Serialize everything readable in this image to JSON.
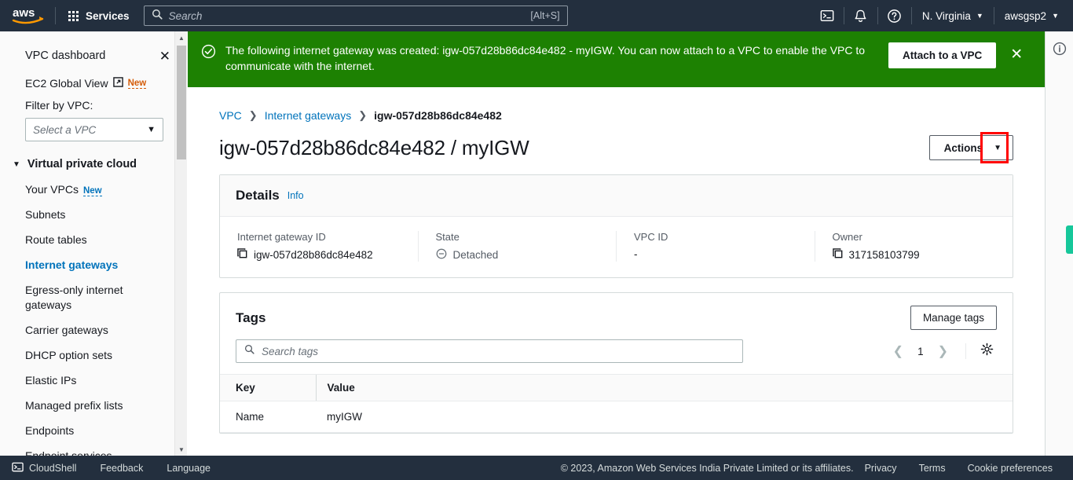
{
  "topnav": {
    "logo_alt": "aws",
    "services_label": "Services",
    "search_placeholder": "Search",
    "search_value": "",
    "search_shortcut": "[Alt+S]",
    "cloudshell_icon": "terminal-icon",
    "notifications_icon": "bell-icon",
    "help_icon": "question-circle-icon",
    "region_label": "N. Virginia",
    "account_label": "awsgsp2"
  },
  "sidebar": {
    "dashboard_label": "VPC dashboard",
    "close_icon": "close-icon",
    "global_view_label": "EC2 Global View",
    "global_view_external_icon": "external-link-icon",
    "global_view_badge": "New",
    "filter_label": "Filter by VPC:",
    "vpc_select_placeholder": "Select a VPC",
    "vpc_select_caret": "chevron-down-icon",
    "section_label": "Virtual private cloud",
    "items": [
      {
        "label": "Your VPCs",
        "badge": "New",
        "active": false
      },
      {
        "label": "Subnets",
        "badge": "",
        "active": false
      },
      {
        "label": "Route tables",
        "badge": "",
        "active": false
      },
      {
        "label": "Internet gateways",
        "badge": "",
        "active": true
      },
      {
        "label": "Egress-only internet gateways",
        "badge": "",
        "active": false
      },
      {
        "label": "Carrier gateways",
        "badge": "",
        "active": false
      },
      {
        "label": "DHCP option sets",
        "badge": "",
        "active": false
      },
      {
        "label": "Elastic IPs",
        "badge": "",
        "active": false
      },
      {
        "label": "Managed prefix lists",
        "badge": "",
        "active": false
      },
      {
        "label": "Endpoints",
        "badge": "",
        "active": false
      },
      {
        "label": "Endpoint services",
        "badge": "",
        "active": false
      }
    ]
  },
  "flash": {
    "status_icon": "check-circle-icon",
    "message": "The following internet gateway was created: igw-057d28b86dc84e482 - myIGW. You can now attach to a VPC to enable the VPC to communicate with the internet.",
    "button_label": "Attach to a VPC",
    "dismiss_icon": "close-icon",
    "background": "#1d8102"
  },
  "breadcrumb": {
    "items": [
      "VPC",
      "Internet gateways",
      "igw-057d28b86dc84e482"
    ]
  },
  "page": {
    "title": "igw-057d28b86dc84e482 / myIGW",
    "actions_label": "Actions",
    "actions_caret": "chevron-down-icon",
    "highlight_color": "#ff0000"
  },
  "details": {
    "title": "Details",
    "info_label": "Info",
    "fields": [
      {
        "label": "Internet gateway ID",
        "value": "igw-057d28b86dc84e482",
        "copy": true,
        "status": ""
      },
      {
        "label": "State",
        "value": "Detached",
        "copy": false,
        "status": "detached"
      },
      {
        "label": "VPC ID",
        "value": "-",
        "copy": false,
        "status": ""
      },
      {
        "label": "Owner",
        "value": "317158103799",
        "copy": true,
        "status": ""
      }
    ]
  },
  "tags": {
    "title": "Tags",
    "manage_label": "Manage tags",
    "search_placeholder": "Search tags",
    "search_value": "",
    "page_number": "1",
    "prev_icon": "chevron-left-icon",
    "next_icon": "chevron-right-icon",
    "settings_icon": "gear-icon",
    "columns": [
      "Key",
      "Value"
    ],
    "rows": [
      {
        "key": "Name",
        "value": "myIGW"
      }
    ]
  },
  "rightrail": {
    "info_icon": "info-circle-icon",
    "feedback_tab": "feedback-tab",
    "feedback_color": "#16c79a"
  },
  "footer": {
    "cloudshell_label": "CloudShell",
    "cloudshell_icon": "terminal-icon",
    "feedback_label": "Feedback",
    "language_label": "Language",
    "copyright": "© 2023, Amazon Web Services India Private Limited or its affiliates.",
    "links": [
      "Privacy",
      "Terms",
      "Cookie preferences"
    ]
  }
}
